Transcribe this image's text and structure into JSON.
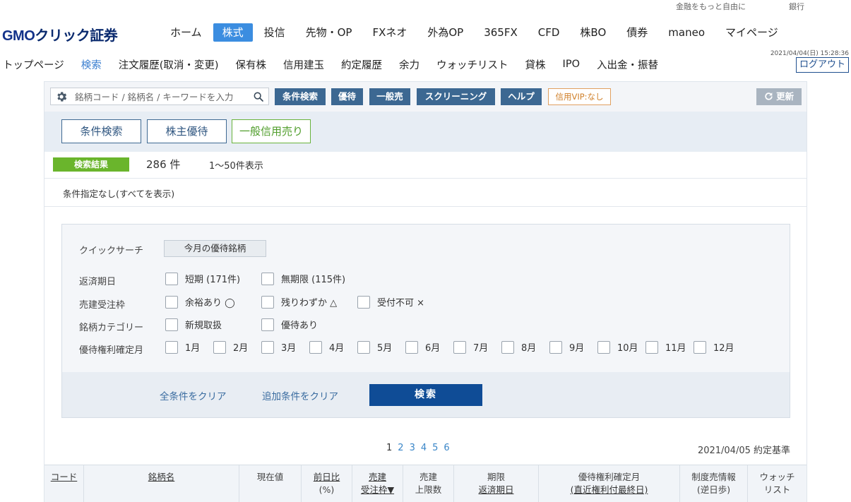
{
  "utility": {
    "links": [
      "金融をもっと自由に",
      "銀行"
    ]
  },
  "brand": {
    "logo_gmo": "GMO",
    "logo_rest": "クリック証券"
  },
  "main_nav": [
    "ホーム",
    "株式",
    "投信",
    "先物・OP",
    "FXネオ",
    "外為OP",
    "365FX",
    "CFD",
    "株BO",
    "債券",
    "maneo",
    "マイページ"
  ],
  "main_nav_active": 1,
  "timestamp": "2021/04/04(日) 15:28:36",
  "sub_nav": [
    "トップページ",
    "検索",
    "注文履歴(取消・変更)",
    "保有株",
    "信用建玉",
    "約定履歴",
    "余力",
    "ウォッチリスト",
    "貸株",
    "IPO",
    "入出金・振替"
  ],
  "sub_nav_active": 1,
  "logout": "ログアウト",
  "toolbar": {
    "search_placeholder": "銘柄コード / 銘柄名 / キーワードを入力",
    "buttons": [
      "条件検索",
      "優待",
      "一般売",
      "スクリーニング",
      "ヘルプ"
    ],
    "vip": "信用VIP:なし",
    "refresh": "更新"
  },
  "tabs": [
    "条件検索",
    "株主優待",
    "一般信用売り"
  ],
  "results": {
    "badge": "検索結果",
    "count": "286 件",
    "range": "1〜50件表示"
  },
  "condition_text": "条件指定なし(すべてを表示)",
  "filters": {
    "quick_label": "クイックサーチ",
    "quick_button": "今月の優待銘柄",
    "repay_label": "返済期日",
    "repay_options": [
      "短期 (171件)",
      "無期限 (115件)"
    ],
    "sell_label": "売建受注枠",
    "sell_options": [
      "余裕あり ◯",
      "残りわずか △",
      "受付不可 ×"
    ],
    "category_label": "銘柄カテゴリー",
    "category_options": [
      "新規取扱",
      "優待あり"
    ],
    "month_label": "優待権利確定月",
    "months": [
      "1月",
      "2月",
      "3月",
      "4月",
      "5月",
      "6月",
      "7月",
      "8月",
      "9月",
      "10月",
      "11月",
      "12月"
    ]
  },
  "actions": {
    "clear_all": "全条件をクリア",
    "clear_extra": "追加条件をクリア",
    "search": "検索"
  },
  "pager": {
    "pages": [
      "1",
      "2",
      "3",
      "4",
      "5",
      "6"
    ],
    "current": "1"
  },
  "base_date": "2021/04/05 約定基準",
  "table_headers": [
    {
      "l1": "コード",
      "l2": "",
      "u1": true,
      "u2": false
    },
    {
      "l1": "銘柄名",
      "l2": "",
      "u1": true,
      "u2": false
    },
    {
      "l1": "現在値",
      "l2": "",
      "u1": false,
      "u2": false
    },
    {
      "l1": "前日比",
      "l2": "(%)",
      "u1": true,
      "u2": false
    },
    {
      "l1": "売建",
      "l2": "受注枠▼",
      "u1": true,
      "u2": true
    },
    {
      "l1": "売建",
      "l2": "上限数",
      "u1": false,
      "u2": false
    },
    {
      "l1": "期限",
      "l2": "返済期日",
      "u1": false,
      "u2": true
    },
    {
      "l1": "優待権利確定月",
      "l2": "(直近権利付最終日)",
      "u1": false,
      "u2": true
    },
    {
      "l1": "制度売情報",
      "l2": "(逆日歩)",
      "u1": false,
      "u2": false
    },
    {
      "l1": "ウォッチ",
      "l2": "リスト",
      "u1": false,
      "u2": false
    }
  ]
}
